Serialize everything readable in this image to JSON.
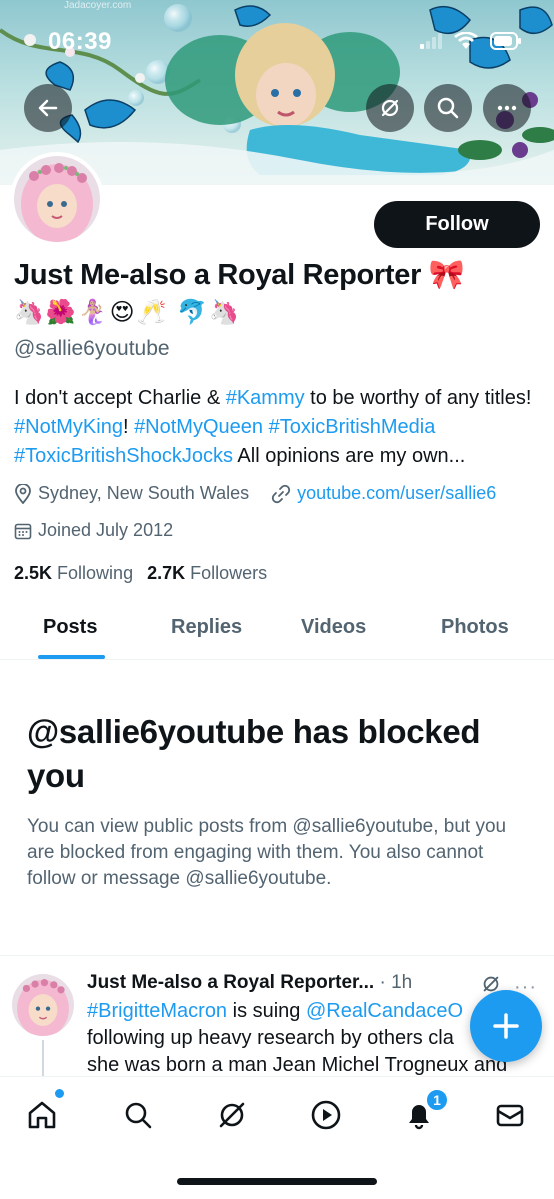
{
  "status_bar": {
    "time": "06:39"
  },
  "banner": {
    "watermark": "Jadacoyer.com"
  },
  "profile": {
    "follow_label": "Follow",
    "name": "Just Me-also a Royal Reporter 🎀",
    "name_emojis": "🦄🌺🧜🏼‍♀️😍🥂 🐬🦄",
    "handle": "@sallie6youtube",
    "bio": {
      "t1": "I don't accept Charlie & ",
      "tag1": "#Kammy",
      "t2": " to be worthy of any titles! ",
      "tag2": "#NotMyKing",
      "t3": "! ",
      "tag3": "#NotMyQueen",
      "t4": " ",
      "tag4": "#ToxicBritishMedia",
      "t5": " ",
      "tag5": "#ToxicBritishShockJocks",
      "t6": " All opinions are my own..."
    },
    "location": "Sydney, New South Wales",
    "website": "youtube.com/user/sallie6",
    "joined": "Joined July 2012",
    "following_count": "2.5K",
    "following_label": "Following",
    "followers_count": "2.7K",
    "followers_label": "Followers"
  },
  "tabs": [
    "Posts",
    "Replies",
    "Videos",
    "Photos"
  ],
  "blocked": {
    "title": "@sallie6youtube has blocked you",
    "description": "You can view public posts from @sallie6youtube, but you are blocked from engaging with them. You also cannot follow or message @sallie6youtube."
  },
  "tweet": {
    "author": "Just Me-also a Royal Reporter...",
    "time": " · 1h",
    "more": "···",
    "line1_tag": "#BrigitteMacron",
    "line1_text": " is suing ",
    "line1_tag2": "@RealCandaceO",
    "line2": "following up heavy research by others cla",
    "line3": "she was born a man Jean Michel Trogneux and"
  },
  "nav": {
    "notification_count": "1"
  },
  "icons": {
    "back": "arrow-left-icon",
    "grok": "grok-icon",
    "search": "search-icon",
    "more": "more-icon",
    "home": "home-icon",
    "explore": "search-icon",
    "grok_nav": "grok-icon",
    "video": "play-icon",
    "notifications": "bell-icon",
    "messages": "mail-icon",
    "compose": "plus-icon"
  },
  "colors": {
    "accent": "#1d9bf0",
    "text": "#0f1419",
    "secondary": "#536471"
  }
}
